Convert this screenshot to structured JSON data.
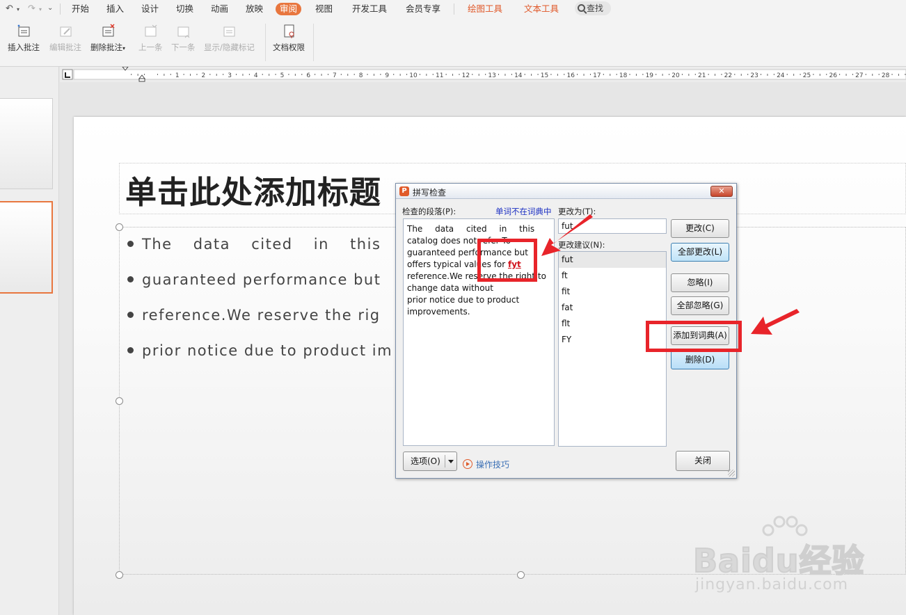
{
  "menubar": {
    "tabs": [
      "开始",
      "插入",
      "设计",
      "切换",
      "动画",
      "放映",
      "审阅",
      "视图",
      "开发工具",
      "会员专享",
      "绘图工具",
      "文本工具"
    ],
    "active_tab": "审阅",
    "search_label": "查找",
    "colors": {
      "active": "#e8763e",
      "context": "#e0592a"
    }
  },
  "ribbon": {
    "buttons": [
      {
        "label": "插入批注",
        "enabled": true,
        "icon": "insert-comment-icon"
      },
      {
        "label": "编辑批注",
        "enabled": false,
        "icon": "edit-comment-icon"
      },
      {
        "label": "删除批注",
        "enabled": true,
        "icon": "delete-comment-icon"
      },
      {
        "label": "上一条",
        "enabled": false,
        "icon": "previous-comment-icon"
      },
      {
        "label": "下一条",
        "enabled": false,
        "icon": "next-comment-icon"
      },
      {
        "label": "显示/隐藏标记",
        "enabled": false,
        "icon": "show-hide-markup-icon"
      },
      {
        "label": "文档权限",
        "enabled": true,
        "icon": "document-permission-icon"
      }
    ]
  },
  "slide": {
    "title": "单击此处添加标题",
    "bullets": [
      "The data cited in this",
      "guaranteed performance but",
      "reference.We reserve the rig",
      "prior notice due to product im"
    ]
  },
  "dialog": {
    "title": "拼写检查",
    "paragraph_label": "检查的段落(P):",
    "not_in_dict_label": "单词不在词典中",
    "change_to_label": "更改为(T):",
    "suggestions_label": "更改建议(N):",
    "paragraph_lines": [
      "The data cited in this",
      "catalog does not refer To",
      "guaranteed performance but",
      "offers typical values for ",
      "reference.We reserve the right to",
      "change data without",
      "prior notice due to product",
      "improvements."
    ],
    "misspelled_word": "fyt",
    "change_to_value": "fut",
    "suggestions": [
      "fut",
      "ft",
      "fit",
      "fat",
      "flt",
      "FY"
    ],
    "buttons": {
      "change": "更改(C)",
      "change_all": "全部更改(L)",
      "ignore": "忽略(I)",
      "ignore_all": "全部忽略(G)",
      "add_to_dict": "添加到词典(A)",
      "delete": "删除(D)",
      "options": "选项(O)",
      "close": "关闭"
    },
    "tips_link": "操作技巧"
  },
  "watermark": {
    "brand": "Baidu经验",
    "url": "jingyan.baidu.com"
  },
  "annotation_color": "#e8242a"
}
